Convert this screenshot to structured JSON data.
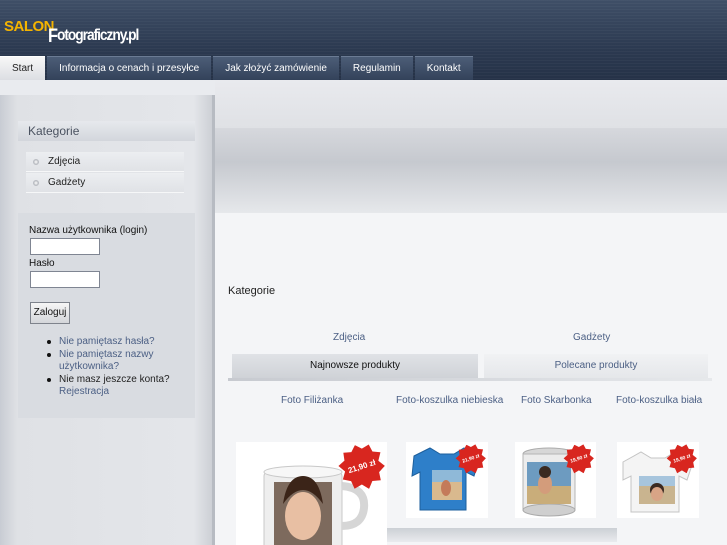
{
  "logo": {
    "part1": "SALON",
    "part2_cap": "F",
    "part2_rest": "otograficzny.pl"
  },
  "nav": {
    "tabs": [
      {
        "label": "Start"
      },
      {
        "label": "Informacja o cenach i przesyłce"
      },
      {
        "label": "Jak złożyć zamówienie"
      },
      {
        "label": "Regulamin"
      },
      {
        "label": "Kontakt"
      }
    ]
  },
  "sidebar": {
    "categories_title": "Kategorie",
    "categories": [
      {
        "label": "Zdjęcia"
      },
      {
        "label": "Gadżety"
      }
    ],
    "login": {
      "username_label": "Nazwa użytkownika (login)",
      "password_label": "Hasło",
      "username_value": "",
      "password_value": "",
      "submit_label": "Zaloguj",
      "links": {
        "forgot_password": "Nie pamiętasz hasła?",
        "forgot_username": "Nie pamiętasz nazwy użytkownika?",
        "no_account": "Nie masz jeszcze konta?",
        "register": "Rejestracja"
      }
    }
  },
  "main": {
    "title": "Kategorie",
    "category_links": [
      {
        "label": "Zdjęcia"
      },
      {
        "label": "Gadżety"
      }
    ],
    "product_tabs": [
      {
        "label": "Najnowsze produkty"
      },
      {
        "label": "Polecane produkty"
      }
    ],
    "products": [
      {
        "name": "Foto Filiżanka",
        "price": "21,90 zł",
        "icon": "mug-photo"
      },
      {
        "name": "Foto-koszulka niebieska",
        "price": "21,90 zł",
        "icon": "blue-tshirt-photo"
      },
      {
        "name": "Foto Skarbonka",
        "price": "19,90 zł",
        "icon": "money-box-photo"
      },
      {
        "name": "Foto-koszulka biała",
        "price": "19,90 zł",
        "icon": "white-tshirt-photo"
      }
    ]
  },
  "colors": {
    "header": "#2c3a51",
    "logo_accent": "#f5b400",
    "link": "#4b5f84",
    "price_badge": "#d8261f"
  }
}
